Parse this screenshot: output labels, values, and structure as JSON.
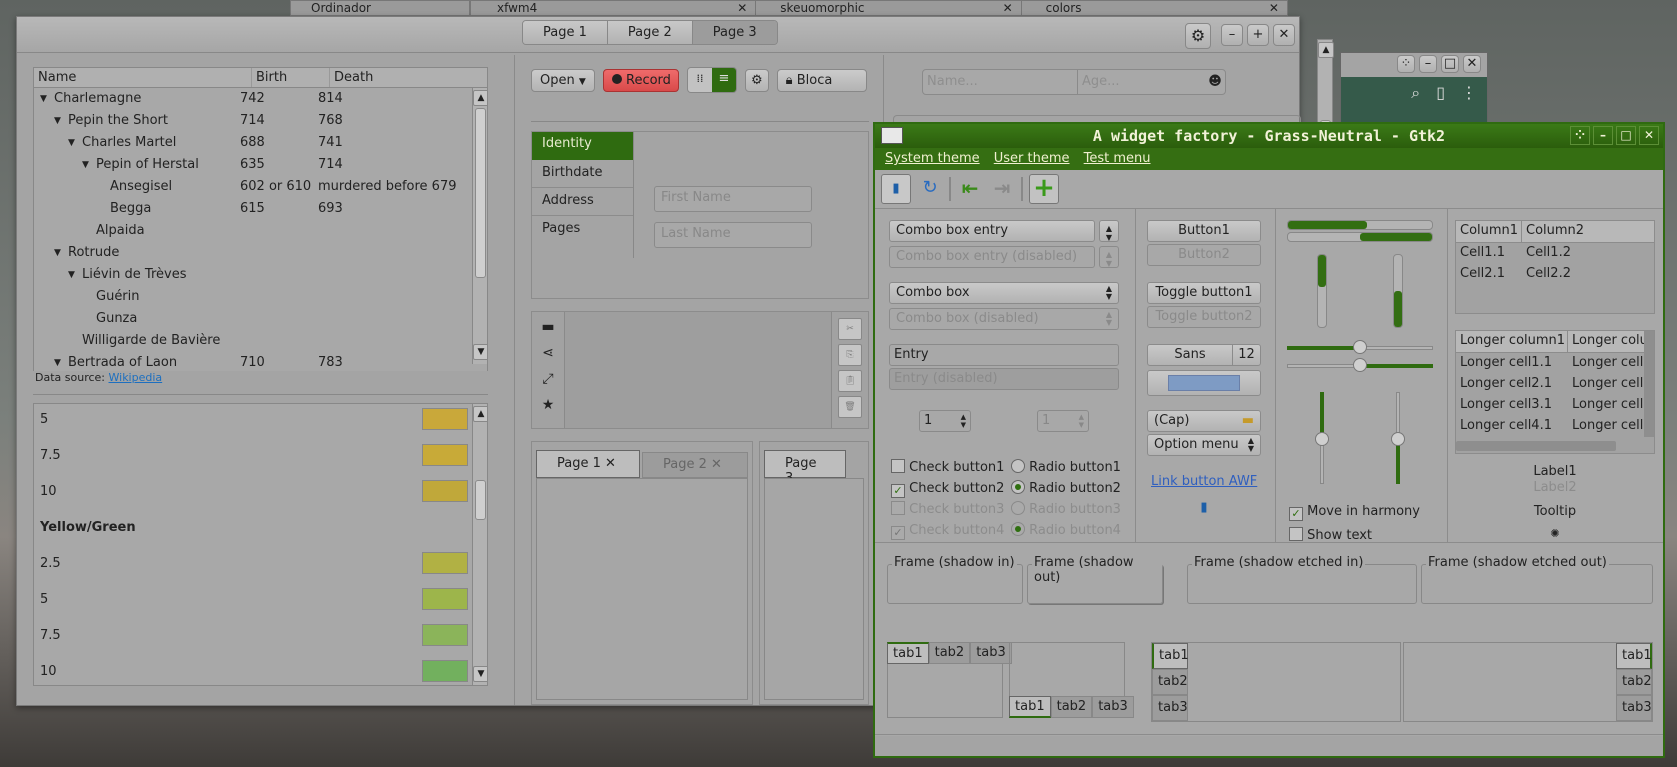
{
  "background_windows": {
    "bg_win1_title": "Ordinador",
    "tab_labels": [
      "xfwm4",
      "skeuomorphic",
      "colors"
    ]
  },
  "main_window": {
    "pages": [
      "Page 1",
      "Page 2",
      "Page 3"
    ],
    "tree": {
      "columns": [
        "Name",
        "Birth",
        "Death"
      ],
      "rows": [
        {
          "name": "Charlemagne",
          "birth": "742",
          "death": "814"
        },
        {
          "name": "Pepin the Short",
          "birth": "714",
          "death": "768"
        },
        {
          "name": "Charles Martel",
          "birth": "688",
          "death": "741"
        },
        {
          "name": "Pepin of Herstal",
          "birth": "635",
          "death": "714"
        },
        {
          "name": "Ansegisel",
          "birth": "602 or 610",
          "death": "murdered before 679"
        },
        {
          "name": "Begga",
          "birth": "615",
          "death": "693"
        },
        {
          "name": "Alpaida",
          "birth": "",
          "death": ""
        },
        {
          "name": "Rotrude",
          "birth": "",
          "death": ""
        },
        {
          "name": "Liévin de Trèves",
          "birth": "",
          "death": ""
        },
        {
          "name": "Guérin",
          "birth": "",
          "death": ""
        },
        {
          "name": "Gunza",
          "birth": "",
          "death": ""
        },
        {
          "name": "Willigarde de Bavière",
          "birth": "",
          "death": ""
        },
        {
          "name": "Bertrada of Laon",
          "birth": "710",
          "death": "783"
        }
      ],
      "data_source_label": "Data source:",
      "data_source_link": "Wikipedia"
    },
    "color_list": {
      "items_top": [
        {
          "label": "5",
          "color": "#c9a83a"
        },
        {
          "label": "7.5",
          "color": "#c8aa38"
        },
        {
          "label": "10",
          "color": "#c0a83a"
        }
      ],
      "group_heading": "Yellow/Green",
      "items_bottom": [
        {
          "label": "2.5",
          "color": "#b1b144"
        },
        {
          "label": "5",
          "color": "#9db54b"
        },
        {
          "label": "7.5",
          "color": "#8bb45a"
        },
        {
          "label": "10",
          "color": "#72b05e"
        }
      ]
    },
    "toolbar": {
      "open": "Open",
      "record": "Record",
      "lock": "Bloca"
    },
    "sidebar_tabs": [
      "Identity",
      "Birthdate",
      "Address",
      "Pages"
    ],
    "first_name_placeholder": "First Name",
    "last_name_placeholder": "Last Name",
    "notebook_tabs": [
      "Page 1",
      "Page 2"
    ],
    "notebook2_tab": "Page 3",
    "name_placeholder": "Name...",
    "age_placeholder": "Age..."
  },
  "gtk2_window": {
    "title": "A widget factory - Grass-Neutral - Gtk2",
    "menu": [
      "System theme",
      "User theme",
      "Test menu"
    ],
    "combo_entry": "Combo box entry",
    "combo_entry_disabled": "Combo box entry (disabled)",
    "combo": "Combo box",
    "combo_disabled": "Combo box (disabled)",
    "entry": "Entry",
    "entry_disabled": "Entry (disabled)",
    "spin1": "1",
    "spin2": "1",
    "checks": [
      "Check button1",
      "Check button2",
      "Check button3",
      "Check button4"
    ],
    "radios": [
      "Radio button1",
      "Radio button2",
      "Radio button3",
      "Radio button4"
    ],
    "button1": "Button1",
    "button2": "Button2",
    "toggle1": "Toggle button1",
    "toggle2": "Toggle button2",
    "font_name": "Sans",
    "font_size": "12",
    "file_chooser": "(Cap)",
    "option_menu": "Option menu",
    "link": "Link button AWF",
    "move_harmony": "Move in harmony",
    "show_text": "Show text",
    "progress": {
      "h1": 0.55,
      "h2": 0.5,
      "v1": 0.45,
      "v2": 0.5
    },
    "table1": {
      "columns": [
        "Column1",
        "Column2"
      ],
      "rows": [
        [
          "Cell1.1",
          "Cell1.2"
        ],
        [
          "Cell2.1",
          "Cell2.2"
        ]
      ]
    },
    "table2": {
      "columns": [
        "Longer column1",
        "Longer colu"
      ],
      "rows": [
        [
          "Longer cell1.1",
          "Longer cell"
        ],
        [
          "Longer cell2.1",
          "Longer cell"
        ],
        [
          "Longer cell3.1",
          "Longer cell"
        ],
        [
          "Longer cell4.1",
          "Longer cell"
        ]
      ]
    },
    "label1": "Label1",
    "label2": "Label2",
    "tooltip": "Tooltip",
    "frames": [
      "Frame (shadow in)",
      "Frame (shadow out)",
      "Frame (shadow etched in)",
      "Frame (shadow etched out)"
    ],
    "tabs": [
      "tab1",
      "tab2",
      "tab3"
    ]
  },
  "colors": {
    "green": "#2f6b10",
    "record": "#e25555"
  }
}
